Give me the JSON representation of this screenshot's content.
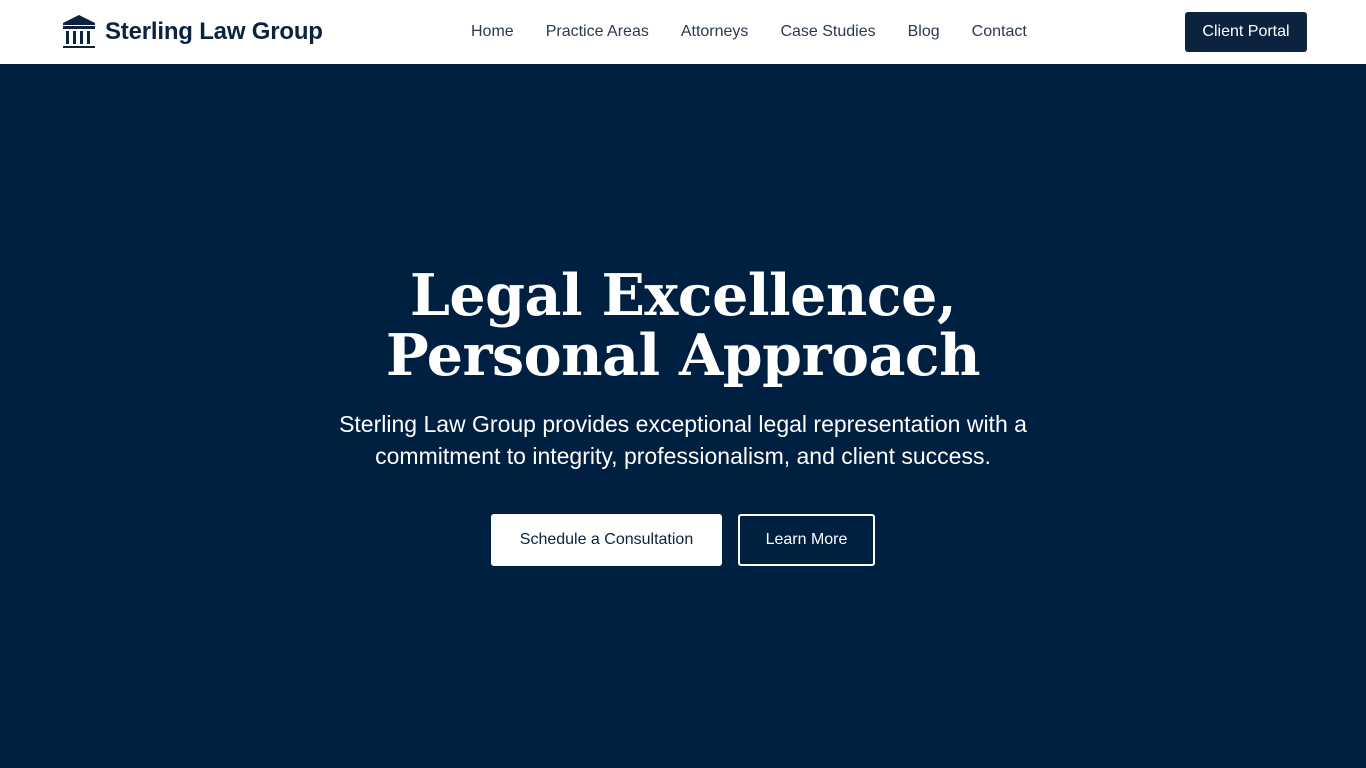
{
  "colors": {
    "brand_navy": "#0c2340",
    "hero_background": "#002042",
    "header_background": "#ffffff",
    "hero_text": "#ffffff"
  },
  "header": {
    "brand": {
      "icon": "courthouse-icon",
      "name": "Sterling Law Group"
    },
    "nav": [
      {
        "label": "Home"
      },
      {
        "label": "Practice Areas"
      },
      {
        "label": "Attorneys"
      },
      {
        "label": "Case Studies"
      },
      {
        "label": "Blog"
      },
      {
        "label": "Contact"
      }
    ],
    "portal_button": "Client Portal"
  },
  "hero": {
    "title": "Legal Excellence, Personal Approach",
    "subtitle": "Sterling Law Group provides exceptional legal representation with a commitment to integrity, professionalism, and client success.",
    "primary_cta": "Schedule a Consultation",
    "secondary_cta": "Learn More"
  }
}
